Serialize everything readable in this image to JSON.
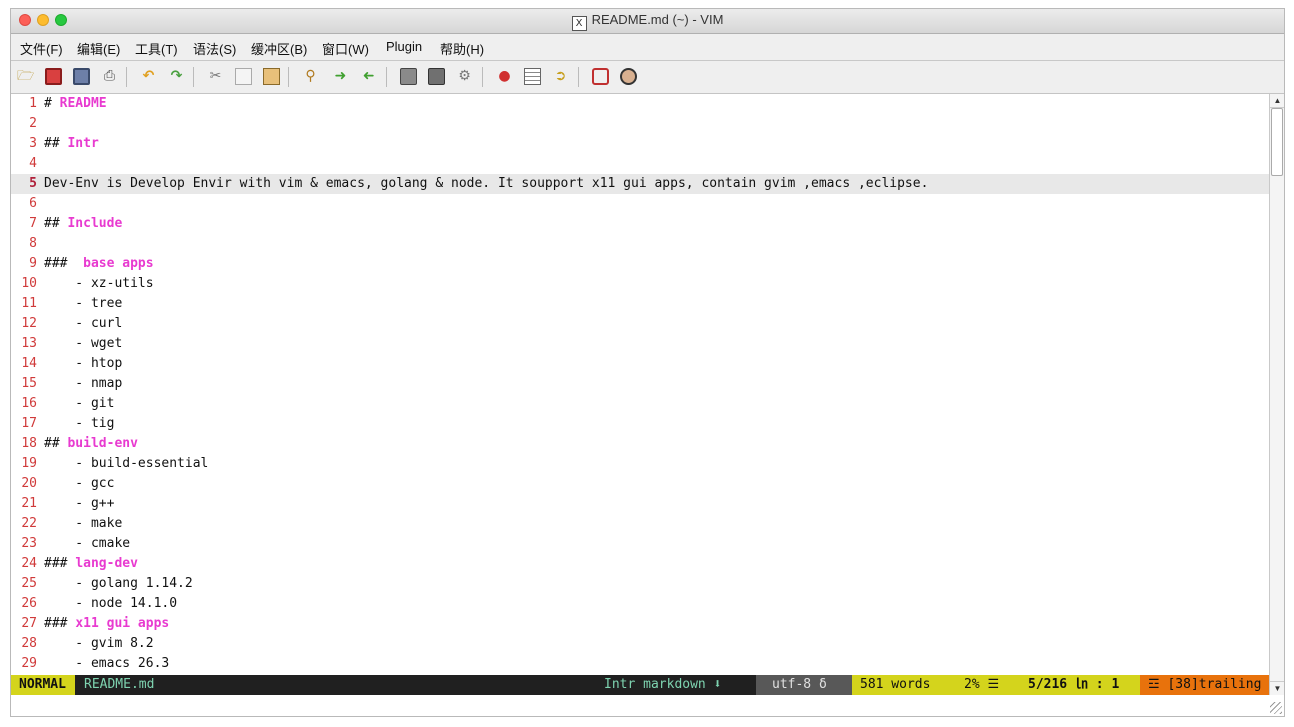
{
  "window": {
    "title": "README.md (~) - VIM",
    "x_icon": "X"
  },
  "menu": [
    "文件(F)",
    "编辑(E)",
    "工具(T)",
    "语法(S)",
    "缓冲区(B)",
    "窗口(W)",
    "Plugin",
    "帮助(H)"
  ],
  "toolbar_icons": [
    "open-icon",
    "save-icon",
    "save-all-icon",
    "print-icon",
    "undo-icon",
    "redo-icon",
    "cut-icon",
    "copy-icon",
    "paste-icon",
    "find-replace-icon",
    "find-next-icon",
    "find-prev-icon",
    "load-session-icon",
    "save-session-icon",
    "run-script-icon",
    "make-icon",
    "shell-icon",
    "tags-jump-icon",
    "help-icon",
    "find-help-icon"
  ],
  "editor": {
    "current_line": 5,
    "lines": [
      {
        "n": "1",
        "parts": [
          {
            "t": "# ",
            "s": "p"
          },
          {
            "t": "README",
            "s": "h"
          }
        ]
      },
      {
        "n": "2",
        "parts": []
      },
      {
        "n": "3",
        "parts": [
          {
            "t": "## ",
            "s": "p"
          },
          {
            "t": "Intr",
            "s": "h"
          }
        ]
      },
      {
        "n": "4",
        "parts": []
      },
      {
        "n": "5",
        "parts": [
          {
            "t": "Dev-Env is Develop Envir with vim & emacs, golang & node. It soupport x11 gui apps, contain gvim ,emacs ,eclipse.",
            "s": "p"
          }
        ]
      },
      {
        "n": "6",
        "parts": []
      },
      {
        "n": "7",
        "parts": [
          {
            "t": "## ",
            "s": "p"
          },
          {
            "t": "Include",
            "s": "h"
          }
        ]
      },
      {
        "n": "8",
        "parts": []
      },
      {
        "n": "9",
        "parts": [
          {
            "t": "###  ",
            "s": "p"
          },
          {
            "t": "base apps",
            "s": "h"
          }
        ]
      },
      {
        "n": "10",
        "parts": [
          {
            "t": "    - xz-utils",
            "s": "p"
          }
        ]
      },
      {
        "n": "11",
        "parts": [
          {
            "t": "    - tree",
            "s": "p"
          }
        ]
      },
      {
        "n": "12",
        "parts": [
          {
            "t": "    - curl",
            "s": "p"
          }
        ]
      },
      {
        "n": "13",
        "parts": [
          {
            "t": "    - wget",
            "s": "p"
          }
        ]
      },
      {
        "n": "14",
        "parts": [
          {
            "t": "    - htop",
            "s": "p"
          }
        ]
      },
      {
        "n": "15",
        "parts": [
          {
            "t": "    - nmap",
            "s": "p"
          }
        ]
      },
      {
        "n": "16",
        "parts": [
          {
            "t": "    - git",
            "s": "p"
          }
        ]
      },
      {
        "n": "17",
        "parts": [
          {
            "t": "    - tig",
            "s": "p"
          }
        ]
      },
      {
        "n": "18",
        "parts": [
          {
            "t": "## ",
            "s": "p"
          },
          {
            "t": "build-env",
            "s": "h"
          }
        ]
      },
      {
        "n": "19",
        "parts": [
          {
            "t": "    - build-essential",
            "s": "p"
          }
        ]
      },
      {
        "n": "20",
        "parts": [
          {
            "t": "    - gcc",
            "s": "p"
          }
        ]
      },
      {
        "n": "21",
        "parts": [
          {
            "t": "    - g++",
            "s": "p"
          }
        ]
      },
      {
        "n": "22",
        "parts": [
          {
            "t": "    - make",
            "s": "p"
          }
        ]
      },
      {
        "n": "23",
        "parts": [
          {
            "t": "    - cmake",
            "s": "p"
          }
        ]
      },
      {
        "n": "24",
        "parts": [
          {
            "t": "### ",
            "s": "p"
          },
          {
            "t": "lang-dev",
            "s": "h"
          }
        ]
      },
      {
        "n": "25",
        "parts": [
          {
            "t": "    - golang 1.14.2",
            "s": "p"
          }
        ]
      },
      {
        "n": "26",
        "parts": [
          {
            "t": "    - node 14.1.0",
            "s": "p"
          }
        ]
      },
      {
        "n": "27",
        "parts": [
          {
            "t": "### ",
            "s": "p"
          },
          {
            "t": "x11 gui apps",
            "s": "h"
          }
        ]
      },
      {
        "n": "28",
        "parts": [
          {
            "t": "    - gvim 8.2",
            "s": "p"
          }
        ]
      },
      {
        "n": "29",
        "parts": [
          {
            "t": "    - emacs 26.3",
            "s": "p"
          }
        ]
      }
    ]
  },
  "statusline": {
    "mode": "NORMAL",
    "file": "README.md",
    "section": "Intr",
    "filetype": "markdown",
    "filetype_icon": "⬇",
    "encoding": "utf-8",
    "encoding_icon": "δ",
    "words": "581 words",
    "percent": "2% ☰",
    "position": "5/216 ㏑ :  1",
    "trailing": "☲ [38]trailing"
  },
  "colors": {
    "line_number": "#d03a3a",
    "heading": "#e83ad0",
    "current_line_bg": "#e8e8e8",
    "status_yellow": "#d4d41c",
    "status_orange": "#e8720c",
    "status_dark": "#202020",
    "status_teal_text": "#7ed3b0"
  }
}
